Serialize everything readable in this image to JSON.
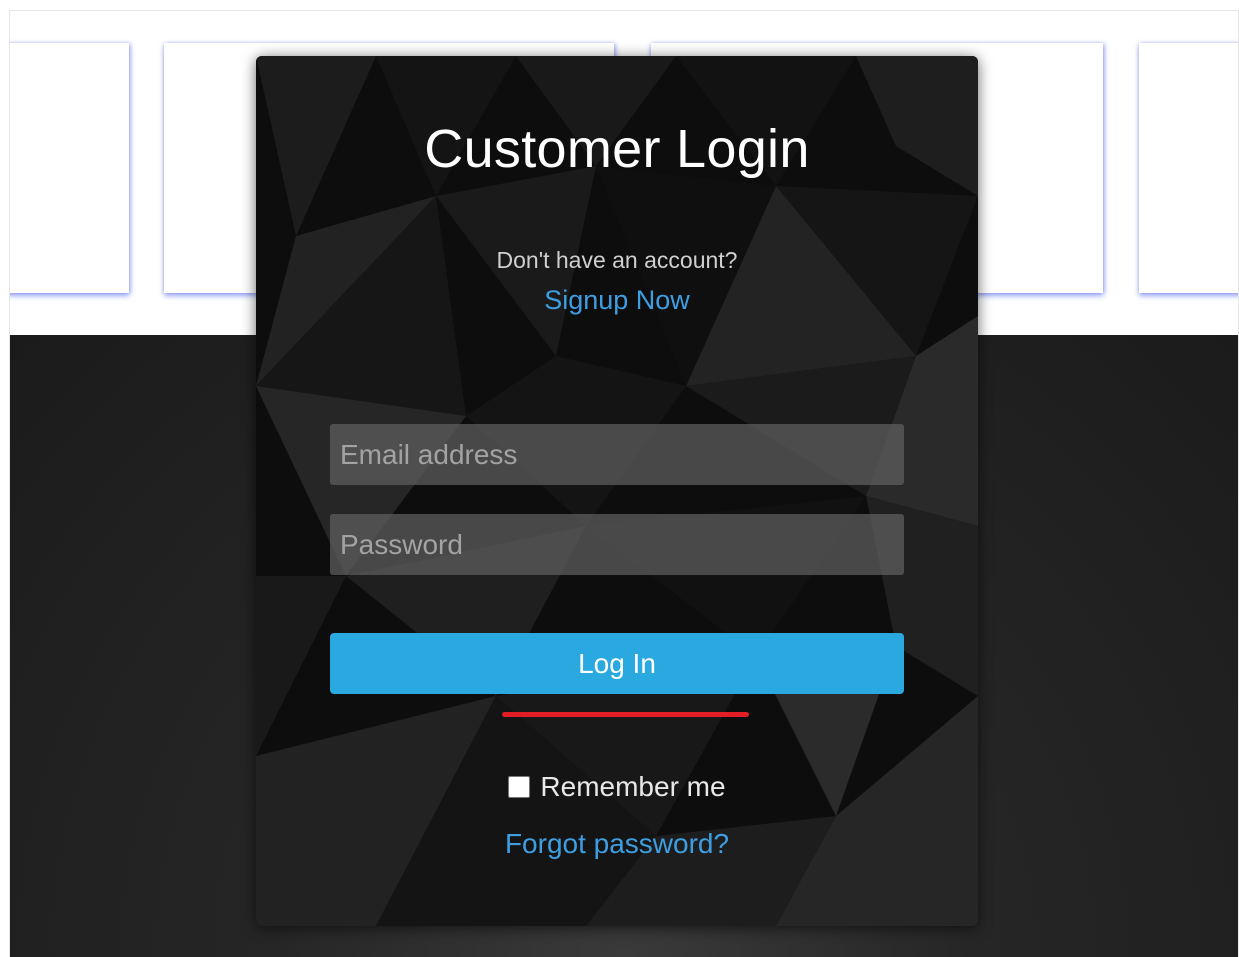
{
  "login": {
    "title": "Customer Login",
    "signup_prompt": "Don't have an account?",
    "signup_link": "Signup Now",
    "email_placeholder": "Email address",
    "password_placeholder": "Password",
    "login_button": "Log In",
    "remember_label": "Remember me",
    "forgot_link": "Forgot password?"
  },
  "colors": {
    "accent_blue": "#2aa9e0",
    "link_blue": "#3d9ee2",
    "underline_red": "#e21d26",
    "panel_dark": "#0e0e0e"
  }
}
